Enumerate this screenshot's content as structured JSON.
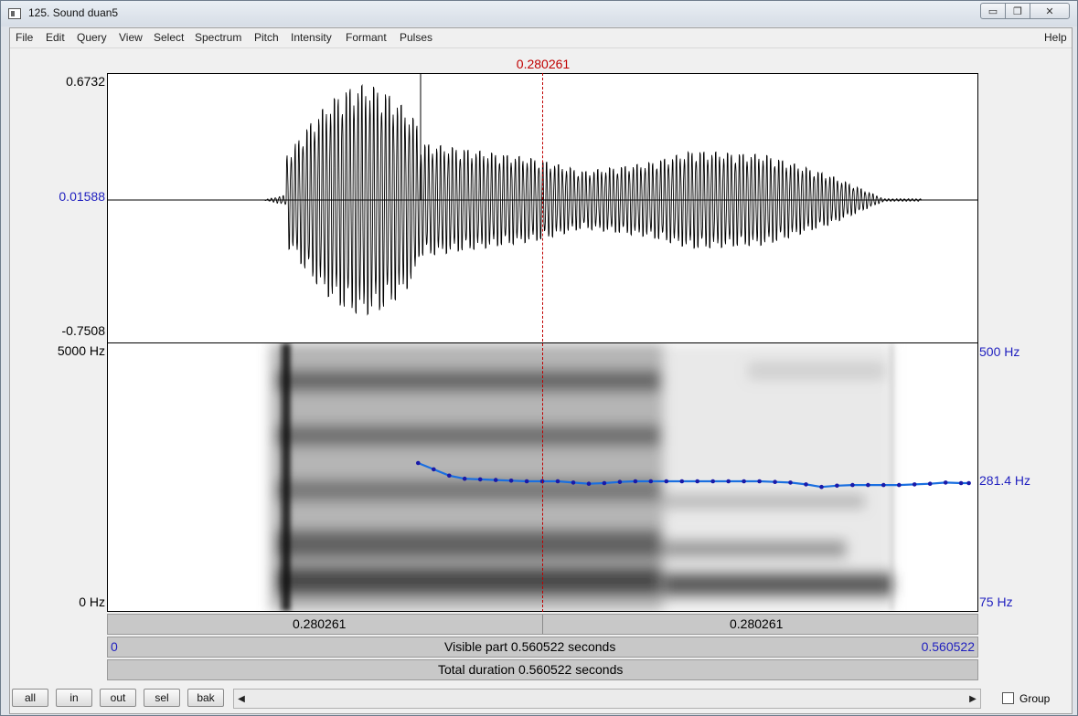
{
  "window": {
    "title": "125. Sound duan5",
    "controls": {
      "minimize": "▭",
      "restore": "❐",
      "close": "✕"
    }
  },
  "menu": {
    "items": [
      "File",
      "Edit",
      "Query",
      "View",
      "Select",
      "Spectrum",
      "Pitch",
      "Intensity",
      "Formant",
      "Pulses"
    ],
    "help": "Help"
  },
  "cursor": {
    "time_label": "0.280261",
    "time": 0.280261
  },
  "waveform": {
    "y_max": "0.6732",
    "y_zero": "0.01588",
    "y_min": "-0.7508"
  },
  "spectrogram": {
    "freq_max": "5000 Hz",
    "freq_min": "0 Hz"
  },
  "pitch": {
    "max": "500 Hz",
    "current": "281.4 Hz",
    "min": "75 Hz",
    "contour": {
      "t": [
        0.2,
        0.21,
        0.22,
        0.23,
        0.24,
        0.25,
        0.26,
        0.27,
        0.28,
        0.29,
        0.3,
        0.31,
        0.32,
        0.33,
        0.34,
        0.35,
        0.36,
        0.37,
        0.38,
        0.39,
        0.4,
        0.41,
        0.42,
        0.43,
        0.44,
        0.45,
        0.46,
        0.47,
        0.48,
        0.49,
        0.5,
        0.51,
        0.52,
        0.53,
        0.54,
        0.55,
        0.555
      ],
      "hz": [
        310,
        300,
        290,
        285,
        284,
        283,
        282,
        281,
        281,
        281,
        279,
        277,
        278,
        280,
        281,
        281,
        281,
        281,
        281,
        281,
        281,
        281,
        281,
        280,
        279,
        276,
        272,
        274,
        275,
        275,
        275,
        275,
        276,
        277,
        279,
        278,
        278
      ]
    }
  },
  "timebars": {
    "left_segment": "0.280261",
    "right_segment": "0.280261",
    "visible_start": "0",
    "visible_end": "0.560522",
    "visible_part": "Visible part 0.560522 seconds",
    "total_duration": "Total duration 0.560522 seconds"
  },
  "buttons": {
    "all": "all",
    "in": "in",
    "out": "out",
    "sel": "sel",
    "bak": "bak"
  },
  "scroll": {
    "left": "◀",
    "right": "▶"
  },
  "group_label": "Group"
}
